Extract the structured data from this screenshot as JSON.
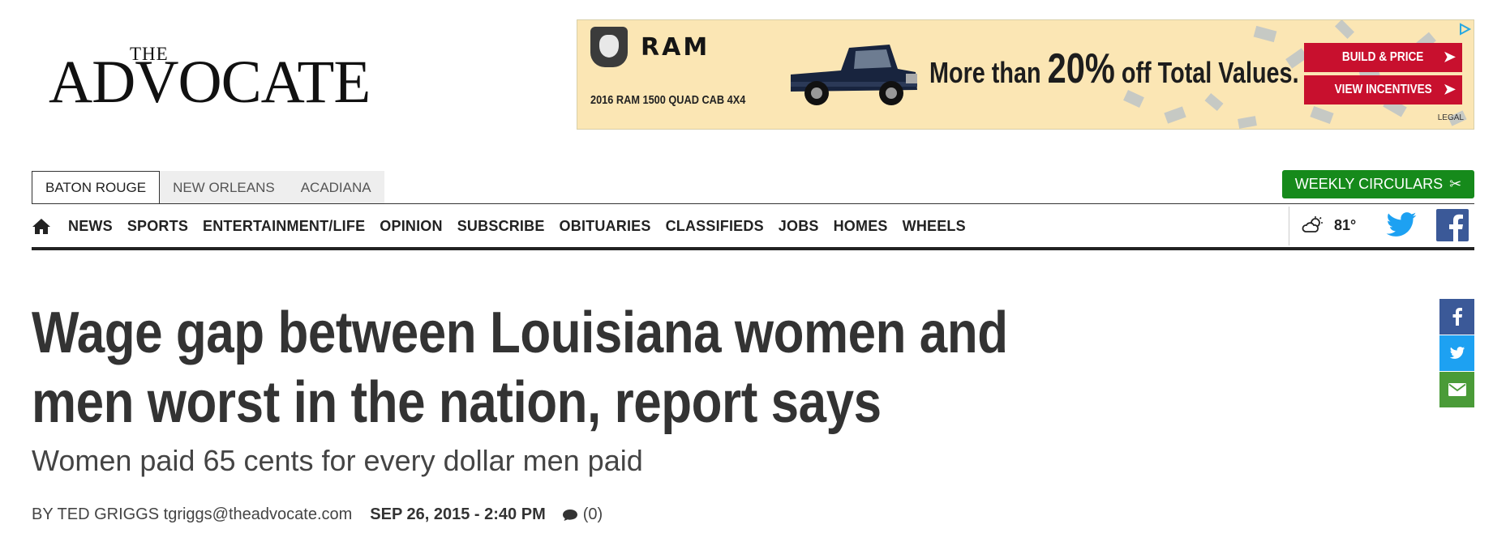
{
  "logo": {
    "the": "THE",
    "name": "ADVOCATE"
  },
  "ad": {
    "brand": "RAM",
    "model": "2016 RAM 1500 QUAD CAB 4X4",
    "headline_pre": "More than ",
    "headline_big": "20%",
    "headline_post": " off Total Values.",
    "button1": "BUILD & PRICE",
    "button2": "VIEW INCENTIVES",
    "legal": "LEGAL",
    "colors": {
      "background": "#fbe6b4",
      "button": "#c8102e"
    }
  },
  "region_tabs": [
    {
      "label": "BATON ROUGE",
      "active": true
    },
    {
      "label": "NEW ORLEANS",
      "active": false
    },
    {
      "label": "ACADIANA",
      "active": false
    }
  ],
  "circulars": {
    "label": "WEEKLY CIRCULARS",
    "icon": "scissors-icon",
    "color": "#168a1b"
  },
  "nav": {
    "home_icon": "home-icon",
    "items": [
      "NEWS",
      "SPORTS",
      "ENTERTAINMENT/LIFE",
      "OPINION",
      "SUBSCRIBE",
      "OBITUARIES",
      "CLASSIFIEDS",
      "JOBS",
      "HOMES",
      "WHEELS"
    ]
  },
  "weather": {
    "icon": "partly-cloudy-icon",
    "temp": "81°"
  },
  "social": {
    "twitter": "twitter-icon",
    "facebook": "facebook-icon"
  },
  "article": {
    "headline": "Wage gap between Louisiana women and men worst in the nation, report says",
    "subhead": "Women paid 65 cents for every dollar men paid",
    "byline": "BY TED GRIGGS tgriggs@theadvocate.com",
    "date": "SEP 26, 2015 - 2:40 PM",
    "comments": "(0)"
  },
  "share": [
    "facebook-share",
    "twitter-share",
    "email-share"
  ]
}
